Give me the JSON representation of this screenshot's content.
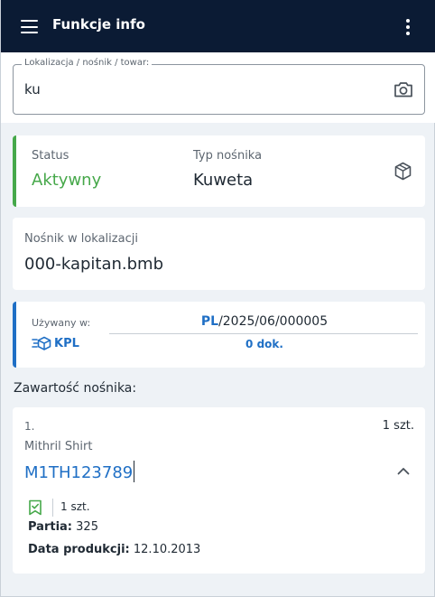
{
  "app_bar": {
    "title": "Funkcje info"
  },
  "search": {
    "legend": "Lokalizacja / nośnik / towar:",
    "value": "ku"
  },
  "status_card": {
    "status_label": "Status",
    "status_value": "Aktywny",
    "type_label": "Typ nośnika",
    "type_value": "Kuweta"
  },
  "location_card": {
    "label": "Nośnik w lokalizacji",
    "value": "000-kapitan.bmb"
  },
  "usage_card": {
    "label": "Używany w:",
    "module": "KPL",
    "doc_prefix": "PL",
    "doc_rest": "/2025/06/000005",
    "doc_count": "0 dok."
  },
  "contents": {
    "title": "Zawartość nośnika:",
    "items": [
      {
        "index": "1.",
        "quantity": "1 szt.",
        "name": "Mithril Shirt",
        "code": "M1TH123789",
        "batch_quantity": "1 szt.",
        "batch_label": "Partia:",
        "batch_value": "325",
        "production_label": "Data produkcji:",
        "production_value": "12.10.2013"
      }
    ]
  },
  "colors": {
    "app_bar": "#0b1b34",
    "active_green": "#46a84a",
    "accent_blue": "#1f6fc5",
    "page_bg": "#eef2f6"
  }
}
